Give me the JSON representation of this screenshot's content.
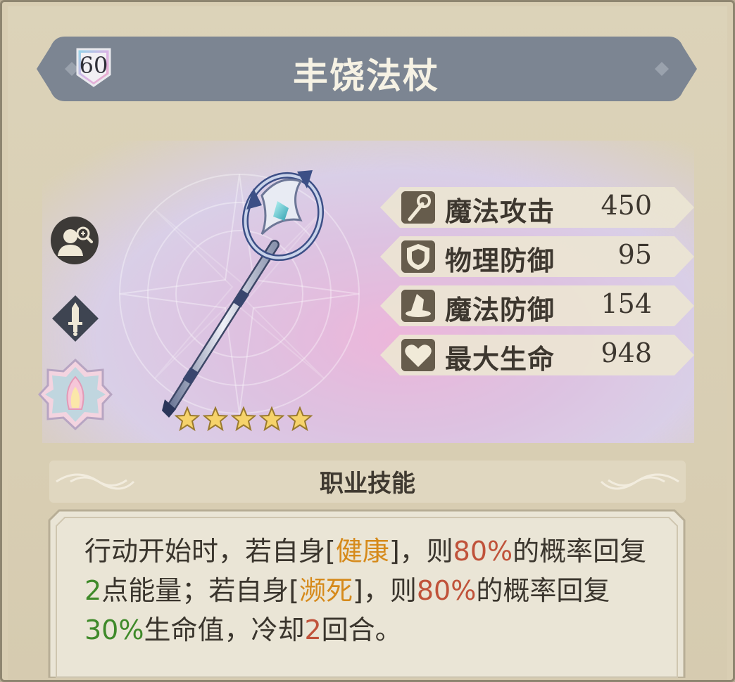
{
  "item": {
    "level": "60",
    "name": "丰饶法杖",
    "stars": 5
  },
  "stats": [
    {
      "icon": "staff-icon",
      "label": "魔法攻击",
      "value": "450"
    },
    {
      "icon": "shield-icon",
      "label": "物理防御",
      "value": "95"
    },
    {
      "icon": "wizard-hat-icon",
      "label": "魔法防御",
      "value": "154"
    },
    {
      "icon": "heart-icon",
      "label": "最大生命",
      "value": "948"
    }
  ],
  "side_icons": [
    "preview-character-icon",
    "sword-class-icon",
    "lotus-emblem-icon"
  ],
  "skill": {
    "title": "职业技能",
    "segments": [
      {
        "text": "行动开始时，若自身[",
        "style": "normal"
      },
      {
        "text": "健康",
        "style": "gold"
      },
      {
        "text": "]，则",
        "style": "normal"
      },
      {
        "text": "80%",
        "style": "red"
      },
      {
        "text": "的概率回复",
        "style": "normal"
      },
      {
        "text": "2",
        "style": "green"
      },
      {
        "text": "点能量；若自身[",
        "style": "normal"
      },
      {
        "text": "濒死",
        "style": "gold"
      },
      {
        "text": "]，则",
        "style": "normal"
      },
      {
        "text": "80%",
        "style": "red"
      },
      {
        "text": "的概率回复",
        "style": "normal"
      },
      {
        "text": "30%",
        "style": "green"
      },
      {
        "text": "生命值，冷却",
        "style": "normal"
      },
      {
        "text": "2",
        "style": "red"
      },
      {
        "text": "回合。",
        "style": "normal"
      }
    ]
  },
  "colors": {
    "panel": "#d9ceb3",
    "banner": "#7c8592",
    "stat_bar": "#ece5d3",
    "gold": "#d68a1b",
    "red": "#c0523a",
    "green": "#3f8a2a"
  }
}
